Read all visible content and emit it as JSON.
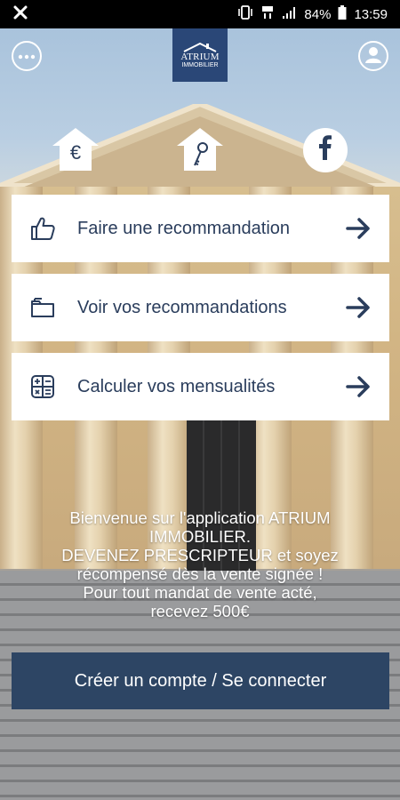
{
  "status_bar": {
    "battery": "84%",
    "time": "13:59"
  },
  "logo": {
    "name": "ATRIUM",
    "sub": "IMMOBILIER"
  },
  "badges": {
    "euro": "€"
  },
  "actions": [
    {
      "label": "Faire une recommandation",
      "icon": "thumbs-up-icon"
    },
    {
      "label": "Voir vos recommandations",
      "icon": "folder-icon"
    },
    {
      "label": "Calculer vos mensualités",
      "icon": "calculator-icon"
    }
  ],
  "welcome": {
    "lines": [
      "Bienvenue sur l'application ATRIUM",
      "IMMOBILIER.",
      "DEVENEZ PRESCRIPTEUR et soyez",
      "récompensé dès la vente signée !",
      "Pour tout mandat de vente acté,",
      "recevez 500€"
    ]
  },
  "cta": {
    "label": "Créer un compte / Se connecter"
  },
  "colors": {
    "brand_navy": "#2a4777",
    "text_navy": "#2a3d5c",
    "button_bg": "#2d4564"
  }
}
